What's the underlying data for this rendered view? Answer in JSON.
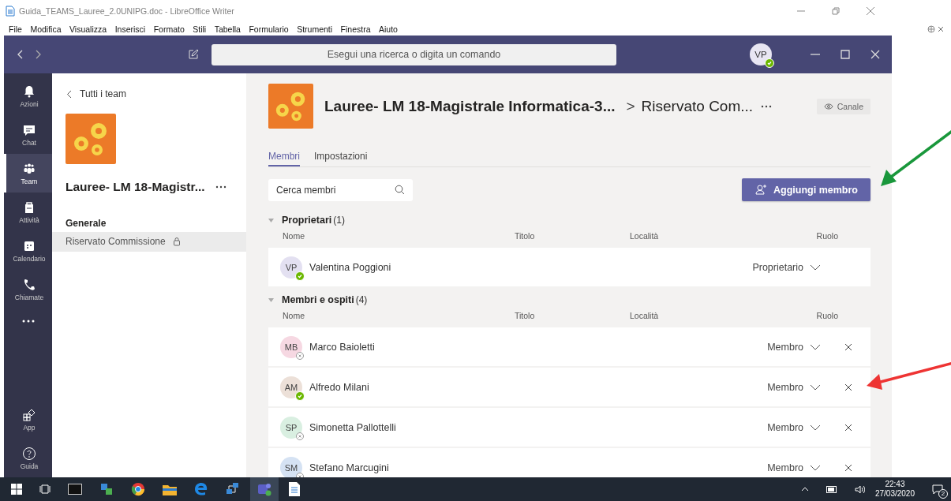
{
  "document_window": {
    "title": "Guida_TEAMS_Lauree_2.0UNIPG.doc - LibreOffice Writer",
    "menu": [
      "File",
      "Modifica",
      "Visualizza",
      "Inserisci",
      "Formato",
      "Stili",
      "Tabella",
      "Formulario",
      "Strumenti",
      "Finestra",
      "Aiuto"
    ]
  },
  "teams": {
    "search": {
      "placeholder": "Esegui una ricerca o digita un comando"
    },
    "profile": {
      "initials": "VP",
      "online": true
    },
    "rail": [
      {
        "label": "Azioni",
        "kind": "bell",
        "selected": false
      },
      {
        "label": "Chat",
        "kind": "chat",
        "selected": false
      },
      {
        "label": "Team",
        "kind": "team",
        "selected": true
      },
      {
        "label": "Attività",
        "kind": "bag",
        "selected": false
      },
      {
        "label": "Calendario",
        "kind": "calendar",
        "selected": false
      },
      {
        "label": "Chiamate",
        "kind": "phone",
        "selected": false
      }
    ],
    "rail_bottom": [
      {
        "label": "App",
        "kind": "apps",
        "selected": false
      },
      {
        "label": "Guida",
        "kind": "help",
        "selected": false
      }
    ],
    "team_panel": {
      "back_label": "Tutti i team",
      "team_name": "Lauree- LM 18-Magistr...",
      "section": "Generale",
      "channels": [
        {
          "name": "Riservato Commissione",
          "private": true,
          "selected": true
        }
      ]
    },
    "header": {
      "team_name": "Lauree- LM 18-Magistrale Informatica-3...",
      "separator": ">",
      "channel": "Riservato Com...",
      "view_button": "Canale"
    },
    "tabs": [
      {
        "label": "Membri",
        "selected": true
      },
      {
        "label": "Impostazioni",
        "selected": false
      }
    ],
    "member_search": {
      "placeholder": "Cerca membri"
    },
    "add_button": "Aggiungi membro",
    "groups": [
      {
        "title": "Proprietari",
        "count": "(1)",
        "expanded": true,
        "columns": [
          "Nome",
          "Titolo",
          "Località",
          "Ruolo"
        ],
        "members": [
          {
            "initials": "VP",
            "name": "Valentina Poggioni",
            "color": "#e3e0f1",
            "online": true,
            "role": "Proprietario",
            "removable": false
          }
        ]
      },
      {
        "title": "Membri e ospiti",
        "count": "(4)",
        "expanded": true,
        "columns": [
          "Nome",
          "Titolo",
          "Località",
          "Ruolo"
        ],
        "members": [
          {
            "initials": "MB",
            "name": "Marco Baioletti",
            "color": "#f6d8e2",
            "online": false,
            "role": "Membro",
            "removable": true
          },
          {
            "initials": "AM",
            "name": "Alfredo Milani",
            "color": "#ece0d8",
            "online": true,
            "role": "Membro",
            "removable": true
          },
          {
            "initials": "SP",
            "name": "Simonetta Pallottelli",
            "color": "#d9efe1",
            "online": false,
            "role": "Membro",
            "removable": true
          },
          {
            "initials": "SM",
            "name": "Stefano Marcugini",
            "color": "#d5e2f3",
            "online": false,
            "role": "Membro",
            "removable": true
          }
        ]
      }
    ]
  },
  "annotations": [
    {
      "kind": "arrow",
      "color": "#19973b"
    },
    {
      "kind": "arrow",
      "color": "#ee3433"
    }
  ],
  "taskbar": {
    "time": "22:43",
    "date": "27/03/2020",
    "notifications": "2"
  }
}
